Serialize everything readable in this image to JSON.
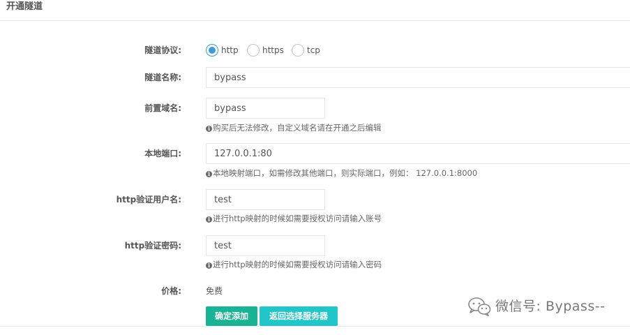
{
  "header": {
    "title": "开通隧道"
  },
  "form": {
    "protocol": {
      "label": "隧道协议:",
      "options": [
        {
          "label": "http",
          "checked": true
        },
        {
          "label": "https",
          "checked": false
        },
        {
          "label": "tcp",
          "checked": false
        }
      ]
    },
    "tunnel_name": {
      "label": "隧道名称:",
      "value": "bypass"
    },
    "prefix_domain": {
      "label": "前置域名:",
      "value": "bypass",
      "help": "购买后无法修改，自定义域名请在开通之后编辑"
    },
    "local_port": {
      "label": "本地端口:",
      "value": "127.0.0.1:80",
      "help": "本地映射端口，如需修改其他端口，则实际端口，例如： 127.0.0.1:8000"
    },
    "http_user": {
      "label": "http验证用户名:",
      "value": "test",
      "help": "进行http映射的时候如需要授权访问请输入账号"
    },
    "http_password": {
      "label": "http验证密码:",
      "value": "test",
      "help": "进行http映射的时候如需要授权访问请输入密码"
    },
    "price": {
      "label": "价格:",
      "value": "免费"
    }
  },
  "actions": {
    "confirm_label": "确定添加",
    "back_label": "返回选择服务器"
  },
  "watermark": {
    "text": "微信号: Bypass--"
  },
  "colors": {
    "primary": "#1ab394",
    "info": "#23c6c8",
    "radio_checked": "#3f9bd6"
  }
}
